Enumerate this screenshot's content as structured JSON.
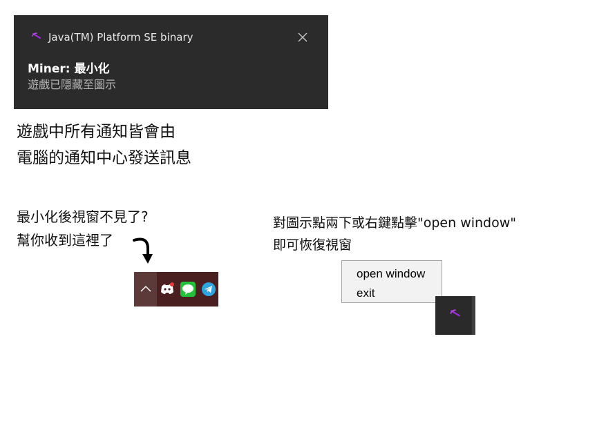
{
  "toast": {
    "app_name": "Java(TM) Platform SE binary",
    "title": "Miner: 最小化",
    "body": "遊戲已隱藏至圖示"
  },
  "notes": {
    "notification_lines": [
      "遊戲中所有通知皆會由",
      "電腦的通知中心發送訊息"
    ],
    "minimize_lines": [
      "最小化後視窗不見了?",
      "幫你收到這裡了"
    ],
    "restore_lines": [
      "對圖示點兩下或右鍵點擊\"open window\"",
      "即可恢復視窗"
    ]
  },
  "tray": {
    "icons": [
      "chevron-up-icon",
      "discord-icon",
      "line-icon",
      "telegram-icon"
    ]
  },
  "context_menu": {
    "items": [
      "open window",
      "exit"
    ]
  },
  "colors": {
    "toast_bg": "#2b2b2b",
    "tray_bg": "#4a1f20",
    "menu_bg": "#f2f2f2",
    "pickaxe": "#9b2bd6"
  }
}
